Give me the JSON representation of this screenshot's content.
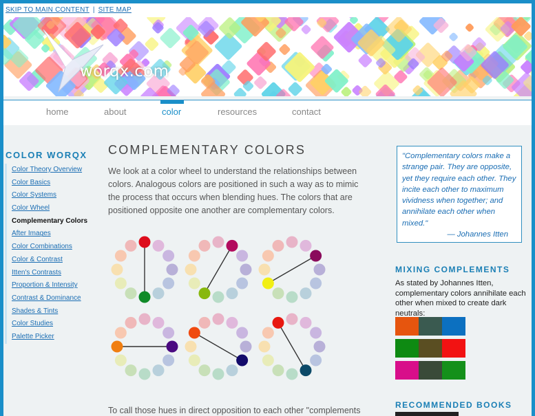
{
  "skip": {
    "skip_link": "SKIP TO MAIN CONTENT",
    "separator": "|",
    "sitemap_link": "SITE MAP"
  },
  "banner": {
    "logo_text": "worqx.com",
    "tile_colors": [
      "#f9b3d9",
      "#ff6fae",
      "#c77dff",
      "#9b7bff",
      "#7fb7ff",
      "#5fd3e8",
      "#7ef0c9",
      "#b8f07a",
      "#f7f37a",
      "#ffd066",
      "#ff9b5a",
      "#ff6b6b"
    ]
  },
  "nav": {
    "items": [
      {
        "label": "home",
        "active": false
      },
      {
        "label": "about",
        "active": false
      },
      {
        "label": "color",
        "active": true
      },
      {
        "label": "resources",
        "active": false
      },
      {
        "label": "contact",
        "active": false
      }
    ]
  },
  "sidebar": {
    "title": "COLOR WORQX",
    "items": [
      {
        "label": "Color Theory Overview",
        "current": false
      },
      {
        "label": "Color Basics",
        "current": false
      },
      {
        "label": "Color Systems",
        "current": false
      },
      {
        "label": "Color Wheel",
        "current": false
      },
      {
        "label": "Complementary Colors",
        "current": true
      },
      {
        "label": "After Images",
        "current": false
      },
      {
        "label": "Color Combinations",
        "current": false
      },
      {
        "label": "Color & Contrast",
        "current": false
      },
      {
        "label": "Itten's Contrasts",
        "current": false
      },
      {
        "label": "Proportion & Intensity",
        "current": false
      },
      {
        "label": "Contrast & Dominance",
        "current": false
      },
      {
        "label": "Shades & Tints",
        "current": false
      },
      {
        "label": "Color Studies",
        "current": false
      },
      {
        "label": "Palette Picker",
        "current": false
      }
    ]
  },
  "main": {
    "title": "COMPLEMENTARY COLORS",
    "intro": "We look at a color wheel to understand the relationships between colors. Analogous colors are positioned in such a way as to mimic the process that occurs when blending hues. The colors that are positioned opposite one another are complementary colors.",
    "bottom_text": "To call those hues in direct opposition to each other \"complements",
    "wheel_colors": [
      "#e8b4c8",
      "#e0b8dc",
      "#c9b6e0",
      "#b8b0d8",
      "#b8c4e0",
      "#b8d0dc",
      "#b8dcc8",
      "#c8e0b8",
      "#e8ecb8",
      "#f8e0b0",
      "#f8c8b0",
      "#f0b8b8"
    ],
    "wheels": [
      {
        "a": {
          "index": 0,
          "color": "#dd0d1c"
        },
        "b": {
          "index": 6,
          "color": "#108a28"
        }
      },
      {
        "a": {
          "index": 1,
          "color": "#b20b5e"
        },
        "b": {
          "index": 7,
          "color": "#88b80e"
        }
      },
      {
        "a": {
          "index": 2,
          "color": "#8a0b5c"
        },
        "b": {
          "index": 8,
          "color": "#f1ef14"
        }
      },
      {
        "a": {
          "index": 9,
          "color": "#f07e10"
        },
        "b": {
          "index": 3,
          "color": "#4a0a80"
        }
      },
      {
        "a": {
          "index": 10,
          "color": "#f04a10"
        },
        "b": {
          "index": 4,
          "color": "#120a6a"
        }
      },
      {
        "a": {
          "index": 11,
          "color": "#e81810"
        },
        "b": {
          "index": 5,
          "color": "#0c4a68"
        }
      }
    ]
  },
  "quote": {
    "text": "\"Complementary colors make a strange pair. They are opposite, yet they require each other. They incite each other to maximum vividness when together; and annihilate each other when mixed.\"",
    "author": "— Johannes Itten"
  },
  "mixing": {
    "title": "MIXING COMPLEMENTS",
    "text": "As stated by Johannes Itten, complementary colors annihilate each other when mixed to create dark neutrals:",
    "rows": [
      [
        "#e6550e",
        "#3a5a50",
        "#0c70c0"
      ],
      [
        "#0e8a12",
        "#5a4e22",
        "#f21212"
      ],
      [
        "#d80e8a",
        "#3a4a38",
        "#14901a"
      ]
    ]
  },
  "books": {
    "title": "RECOMMENDED BOOKS"
  }
}
